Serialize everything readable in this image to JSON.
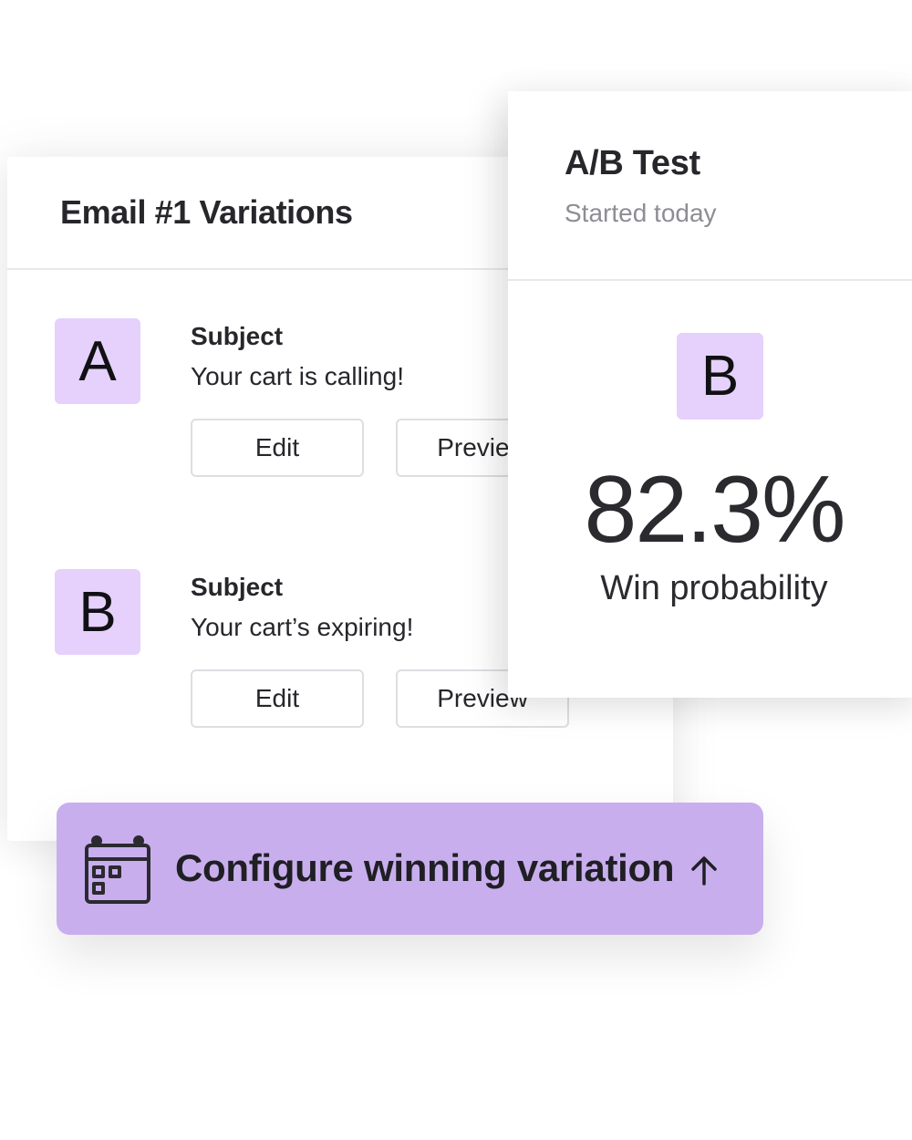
{
  "variations_card": {
    "title": "Email #1 Variations",
    "variations": [
      {
        "letter": "A",
        "subject_label": "Subject",
        "subject": "Your cart is calling!",
        "edit_label": "Edit",
        "preview_label": "Preview"
      },
      {
        "letter": "B",
        "subject_label": "Subject",
        "subject": "Your cart’s expiring!",
        "edit_label": "Edit",
        "preview_label": "Preview"
      }
    ]
  },
  "ab_test": {
    "title": "A/B Test",
    "status": "Started today",
    "winner_letter": "B",
    "win_probability": "82.3%",
    "win_probability_label": "Win probability"
  },
  "configure_button": {
    "label": "Configure winning variation",
    "icon": "calendar-icon",
    "trailing_icon": "arrow-up-icon"
  },
  "colors": {
    "badge_purple": "#e5d1fb",
    "button_purple": "#c9aeee",
    "text_dark": "#26262b",
    "text_muted": "#8d8d94"
  }
}
